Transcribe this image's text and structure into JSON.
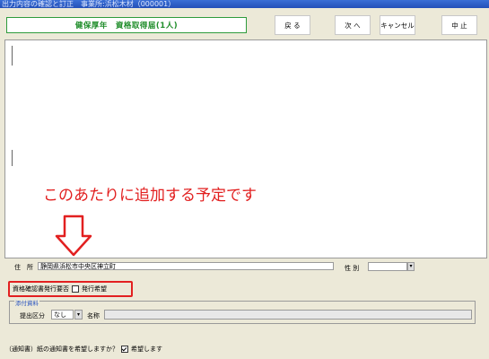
{
  "window": {
    "title": "出力内容の確認と訂正　事業所:浜松木材（000001）"
  },
  "header": {
    "title": "健保厚年　資格取得届(1人)"
  },
  "nav": {
    "back": "戻 る",
    "next": "次 へ",
    "cancel": "キャンセル",
    "abort": "中 止"
  },
  "annotation": {
    "text": "このあたりに追加する予定です",
    "color": "#e22020"
  },
  "address": {
    "label": "住　所",
    "value": "静岡県浜松市中央区神立町"
  },
  "gender": {
    "label": "性 別"
  },
  "certificate": {
    "label": "資格確認書発行要否",
    "checkbox_label": "発行希望",
    "checked": false
  },
  "attachment": {
    "legend": "添付資料",
    "submit_label": "提出区分",
    "submit_value": "なし",
    "name_label": "名称",
    "name_value": ""
  },
  "notice": {
    "label": "（通知書）紙の通知書を希望しますか？",
    "checkbox_label": "希望します",
    "checked": true
  },
  "colors": {
    "accent_green": "#1f8d2a",
    "highlight_red": "#e22020",
    "legend_blue": "#2b55c0"
  }
}
